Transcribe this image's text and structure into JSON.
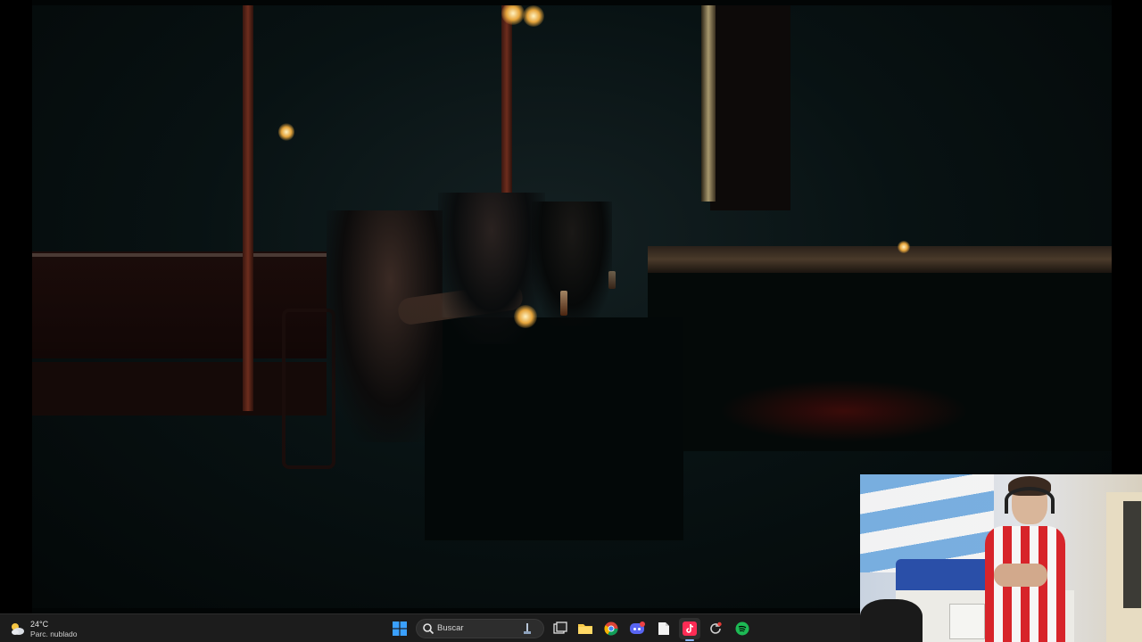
{
  "taskbar": {
    "weather": {
      "temperature": "24°C",
      "condition": "Parc. nublado",
      "icon": "partly-cloudy-icon"
    },
    "search": {
      "placeholder": "Buscar"
    },
    "pinned_apps": [
      {
        "name": "Start",
        "icon": "windows-start-icon"
      },
      {
        "name": "Task View",
        "icon": "task-view-icon"
      },
      {
        "name": "File Explorer",
        "icon": "folder-icon"
      },
      {
        "name": "Chrome",
        "icon": "chrome-icon"
      },
      {
        "name": "Discord",
        "icon": "discord-icon",
        "badge": "9+"
      },
      {
        "name": "Documents",
        "icon": "file-icon"
      },
      {
        "name": "TikTok",
        "icon": "tiktok-icon",
        "active": true
      },
      {
        "name": "Refresh",
        "icon": "refresh-icon"
      },
      {
        "name": "Spotify",
        "icon": "spotify-icon"
      }
    ]
  },
  "colors": {
    "taskbar_bg": "#1c1c1c",
    "tiktok": "#fe2c55",
    "spotify": "#1db954",
    "windows_blue": "#3aa0ff"
  }
}
